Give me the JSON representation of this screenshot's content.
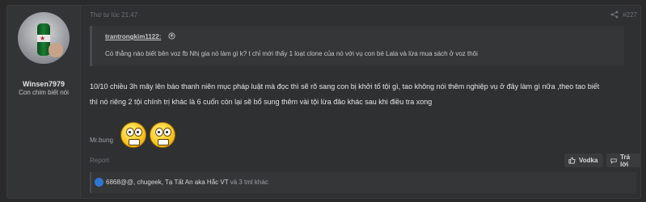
{
  "user": {
    "name": "Winsen7979",
    "title": "Con chim biết nói"
  },
  "post": {
    "timestamp": "Thứ tư lúc 21:47",
    "number": "#227",
    "quote": {
      "author": "trantrongkim1122:",
      "text": "Có thằng nào biết bên voz fb Nhị gia nó làm gì k? t chỉ mới thấy 1 loạt clone của nó với vụ con bé Lala và lừa mua sách ở voz thôi"
    },
    "body_lines": [
      "10/10 chiều 3h mây lên báo thanh niên mục pháp luật mà đọc thì sẽ rõ sang con bị khởi tố tội gì, tao không nói thêm nghiệp vụ ở đây làm gì nữa ,theo tao biết",
      "thì nó riêng 2 tội chính trị khác là 6 cuốn còn lại sẽ bổ sung thêm vài tội lừa đảo khác sau khi điều tra xong"
    ],
    "signature": "Mr.bung",
    "report_label": "Report",
    "like_label": "Vodka",
    "reply_label": "Trả lời"
  },
  "reactions": {
    "names": "6868@@, chugeek, Tạ Tất An aka Hắc VT",
    "others": "và 3 tml khác"
  },
  "colors": {
    "background": "#2a2a2a",
    "post_bg": "#2f3032",
    "reaction_icon": "#2c78d4"
  },
  "icons": [
    "share-icon",
    "quote-arrow-icon",
    "smiley-icon",
    "thumbs-up-icon",
    "reply-icon",
    "like-reaction-icon"
  ]
}
